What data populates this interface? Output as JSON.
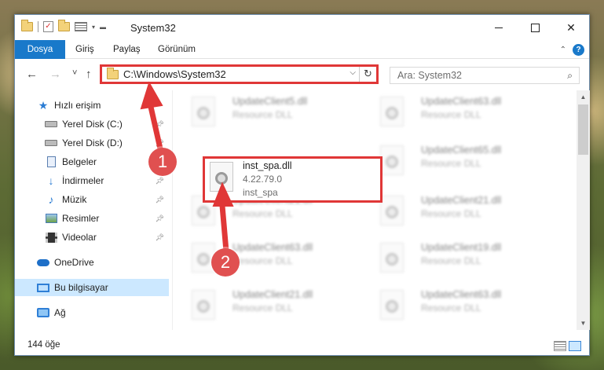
{
  "window": {
    "title": "System32",
    "controls": {
      "minimize": "",
      "maximize": "",
      "close": "✕"
    }
  },
  "ribbon": {
    "tabs": [
      "Dosya",
      "Giriş",
      "Paylaş",
      "Görünüm"
    ],
    "collapse_icon": "chevron-up-icon",
    "help": "?"
  },
  "navbar": {
    "back": "←",
    "forward": "→",
    "recent": "˅",
    "up": "↑",
    "address": "C:\\Windows\\System32",
    "address_dropdown": "⌵",
    "refresh": "↻",
    "search_placeholder": "Ara: System32",
    "search_icon": "⌕"
  },
  "sidebar": {
    "items": [
      {
        "label": "Hızlı erişim",
        "icon": "star-icon",
        "pinned": false
      },
      {
        "label": "Yerel Disk (C:)",
        "icon": "drive-icon",
        "pinned": true
      },
      {
        "label": "Yerel Disk (D:)",
        "icon": "drive-icon",
        "pinned": true
      },
      {
        "label": "Belgeler",
        "icon": "documents-icon",
        "pinned": true
      },
      {
        "label": "İndirmeler",
        "icon": "downloads-icon",
        "pinned": true
      },
      {
        "label": "Müzik",
        "icon": "music-icon",
        "pinned": true
      },
      {
        "label": "Resimler",
        "icon": "pictures-icon",
        "pinned": true
      },
      {
        "label": "Videolar",
        "icon": "videos-icon",
        "pinned": true
      },
      {
        "label": "OneDrive",
        "icon": "onedrive-icon",
        "pinned": false
      },
      {
        "label": "Bu bilgisayar",
        "icon": "computer-icon",
        "pinned": false,
        "selected": true
      },
      {
        "label": "Ağ",
        "icon": "network-icon",
        "pinned": false
      }
    ]
  },
  "files": {
    "selected": {
      "name": "inst_spa.dll",
      "version": "4.22.79.0",
      "description": "inst_spa"
    },
    "items": [
      {
        "name": "UpdateClient5.dll",
        "type": "Resource DLL"
      },
      {
        "name": "UpdateClient63.dll",
        "type": "Resource DLL"
      },
      {
        "name": "UpdateClient65.dll",
        "type": "Resource DLL"
      },
      {
        "name": "UpdateClient21.dll",
        "type": "Resource DLL"
      },
      {
        "name": "UpdateClient21.dll",
        "type": "Resource DLL"
      },
      {
        "name": "UpdateClient63.dll",
        "type": "Resource DLL"
      },
      {
        "name": "UpdateClient19.dll",
        "type": "Resource DLL"
      },
      {
        "name": "UpdateClient21.dll",
        "type": "Resource DLL"
      },
      {
        "name": "UpdateClient63.dll",
        "type": "Resource DLL"
      }
    ]
  },
  "status": {
    "item_count": "144 öğe"
  },
  "annotations": {
    "badge1": "1",
    "badge2": "2",
    "color": "#e03737"
  }
}
